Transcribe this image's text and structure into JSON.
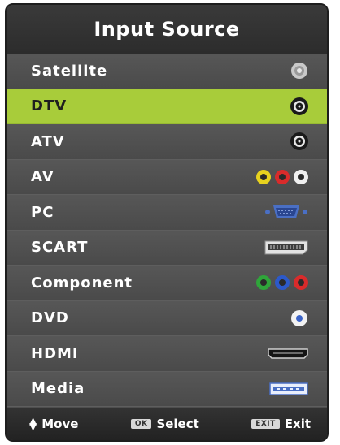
{
  "title": "Input Source",
  "items": [
    {
      "label": "Satellite",
      "icon": "satellite-port-icon",
      "selected": false
    },
    {
      "label": "DTV",
      "icon": "antenna-port-icon",
      "selected": true
    },
    {
      "label": "ATV",
      "icon": "antenna-port-icon",
      "selected": false
    },
    {
      "label": "AV",
      "icon": "composite-av-icon",
      "selected": false
    },
    {
      "label": "PC",
      "icon": "vga-port-icon",
      "selected": false
    },
    {
      "label": "SCART",
      "icon": "scart-port-icon",
      "selected": false
    },
    {
      "label": "Component",
      "icon": "component-port-icon",
      "selected": false
    },
    {
      "label": "DVD",
      "icon": "dvd-port-icon",
      "selected": false
    },
    {
      "label": "HDMI",
      "icon": "hdmi-port-icon",
      "selected": false
    },
    {
      "label": "Media",
      "icon": "usb-port-icon",
      "selected": false
    }
  ],
  "footer": {
    "move_label": "Move",
    "ok_key": "OK",
    "select_label": "Select",
    "exit_key": "EXIT",
    "exit_label": "Exit"
  },
  "colors": {
    "highlight": "#a8cc3a",
    "panel": "#4e4e4e",
    "header": "#2f2f2f"
  }
}
